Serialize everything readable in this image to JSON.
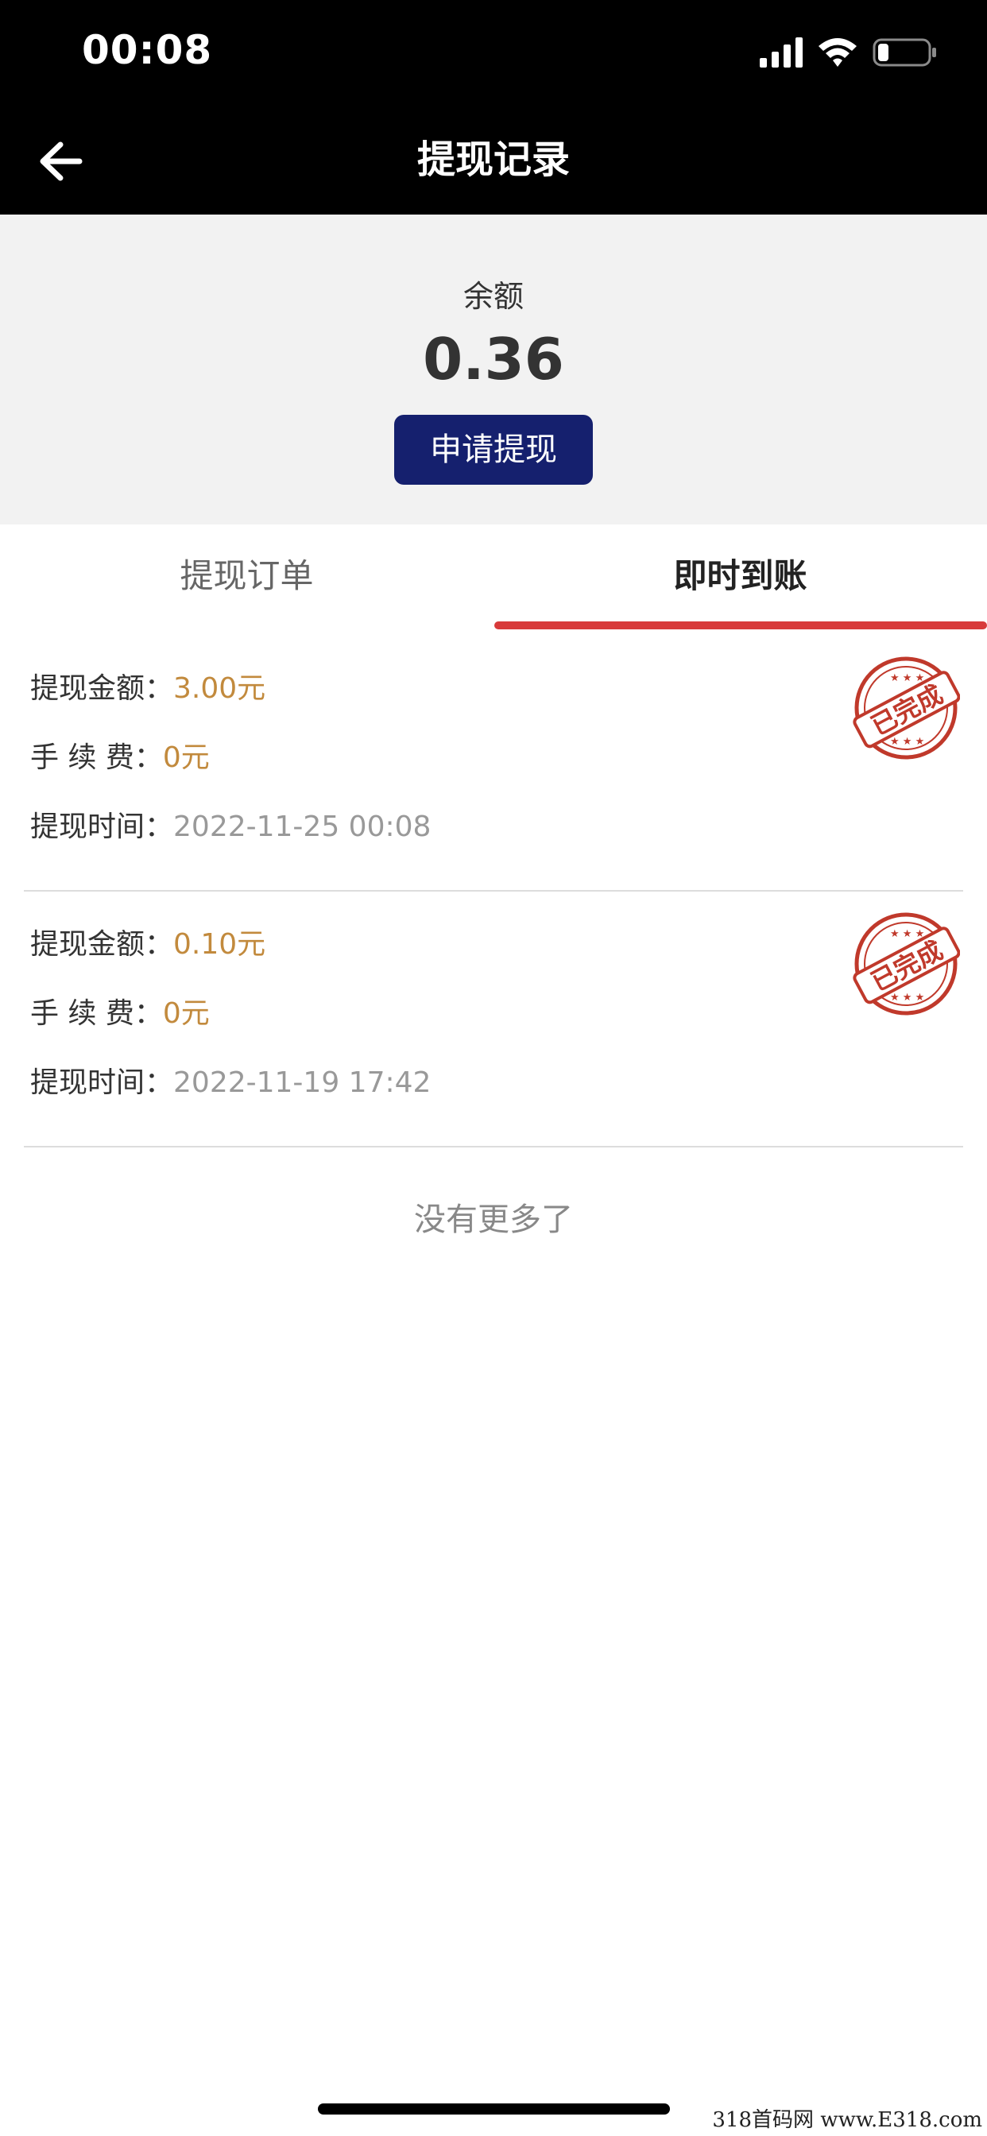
{
  "status_bar": {
    "time": "00:08"
  },
  "nav": {
    "title": "提现记录"
  },
  "balance": {
    "label": "余额",
    "value": "0.36",
    "button": "申请提现"
  },
  "tabs": [
    {
      "label": "提现订单",
      "active": false
    },
    {
      "label": "即时到账",
      "active": true
    }
  ],
  "accent": {
    "tab_indicator": "#d83a3a",
    "button": "#15206e",
    "amount": "#c28a3d",
    "stamp": "#c0392b"
  },
  "records": [
    {
      "amount_label": "提现金额：",
      "amount": "3.00元",
      "fee_label": "手 续 费：",
      "fee": "0元",
      "time_label": "提现时间：",
      "time": "2022-11-25 00:08",
      "stamp": "已完成"
    },
    {
      "amount_label": "提现金额：",
      "amount": "0.10元",
      "fee_label": "手 续 费：",
      "fee": "0元",
      "time_label": "提现时间：",
      "time": "2022-11-19 17:42",
      "stamp": "已完成"
    }
  ],
  "footer": {
    "no_more": "没有更多了"
  },
  "watermark": "318首码网 www.E318.com"
}
